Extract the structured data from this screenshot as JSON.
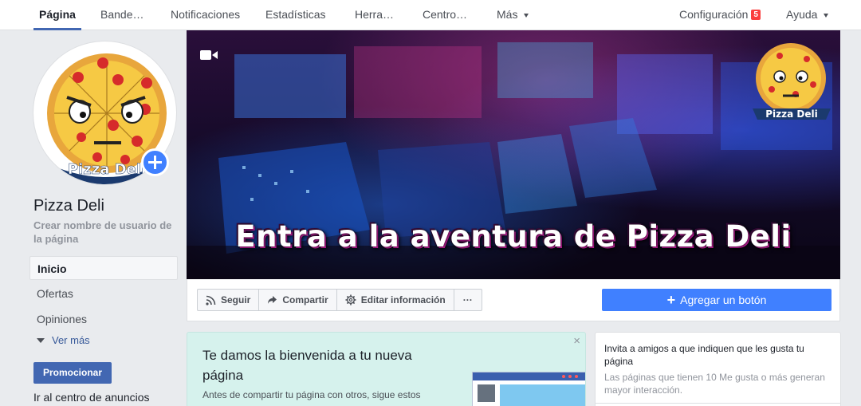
{
  "nav": {
    "items": [
      {
        "label": "Página",
        "active": true
      },
      {
        "label": "Bande…"
      },
      {
        "label": "Notificaciones"
      },
      {
        "label": "Estadísticas"
      },
      {
        "label": "Herra…"
      },
      {
        "label": "Centro…"
      },
      {
        "label": "Más"
      }
    ],
    "config_label": "Configuración",
    "config_badge": "5",
    "help_label": "Ayuda"
  },
  "page": {
    "name": "Pizza Deli",
    "username_link": "Crear nombre de usuario de la página",
    "logo_text": "Pizza Deli"
  },
  "sidebar": {
    "items": [
      {
        "label": "Inicio",
        "active": true
      },
      {
        "label": "Ofertas"
      },
      {
        "label": "Opiniones"
      }
    ],
    "see_more": "Ver más",
    "promote": "Promocionar",
    "ads_center": "Ir al centro de anuncios"
  },
  "cover": {
    "headline": "Entra a la aventura de Pizza Deli"
  },
  "actions": {
    "follow": "Seguir",
    "share": "Compartir",
    "edit_info": "Editar información",
    "more": "···",
    "add_button": "Agregar un botón"
  },
  "welcome": {
    "close": "×",
    "title": "Te damos la bienvenida a tu nueva página",
    "body": "Antes de compartir tu página con otros, sigue estos"
  },
  "invite": {
    "title": "Invita a amigos a que indiquen que les gusta tu página",
    "body": "Las páginas que tienen 10 Me gusta o más generan mayor interacción."
  },
  "colors": {
    "brand_blue": "#4267b2",
    "accent_blue": "#4080ff",
    "badge_red": "#fa3e3e",
    "welcome_bg": "#d6f2ed"
  }
}
